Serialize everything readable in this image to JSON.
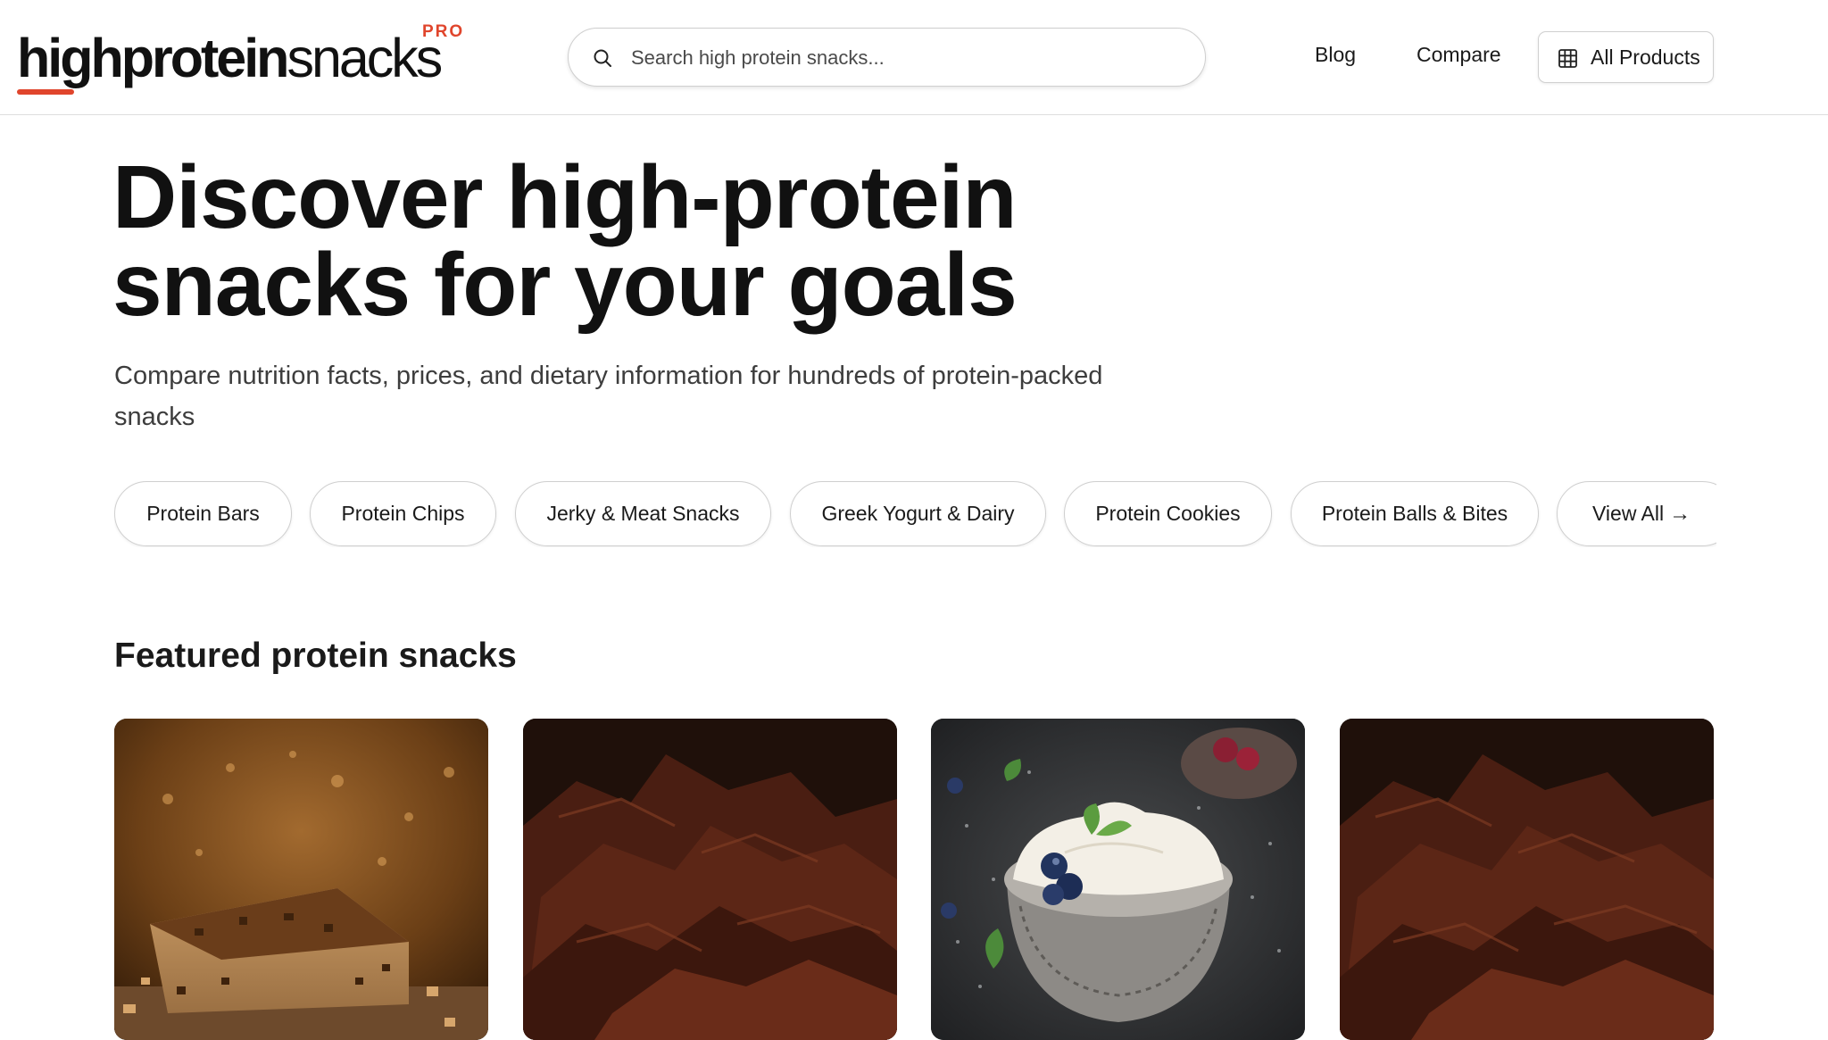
{
  "header": {
    "logo": {
      "bold_part": "highprotein",
      "light_part": "snacks",
      "badge": "PRO",
      "accent_color": "#e0452c"
    },
    "search": {
      "placeholder": "Search high protein snacks...",
      "icon": "search-icon"
    },
    "nav": {
      "blog": "Blog",
      "compare": "Compare",
      "all_products": "All Products",
      "all_products_icon": "grid-icon"
    }
  },
  "hero": {
    "title_line1": "Discover high-protein",
    "title_line2": "snacks for your goals",
    "subtitle": "Compare nutrition facts, prices, and dietary information for hundreds of protein-packed snacks"
  },
  "categories": [
    "Protein Bars",
    "Protein Chips",
    "Jerky & Meat Snacks",
    "Greek Yogurt & Dairy",
    "Protein Cookies",
    "Protein Balls & Bites"
  ],
  "view_all": {
    "label": "View All",
    "arrow": "→"
  },
  "featured": {
    "title": "Featured protein snacks",
    "cards": [
      {
        "image": "protein-bar-image"
      },
      {
        "image": "beef-jerky-image"
      },
      {
        "image": "greek-yogurt-bowl-image"
      },
      {
        "image": "beef-jerky-image"
      }
    ]
  }
}
